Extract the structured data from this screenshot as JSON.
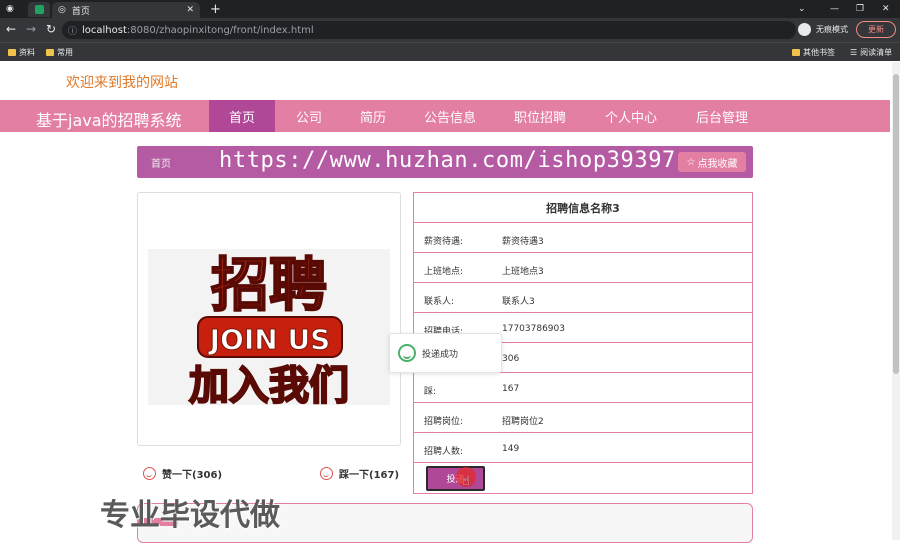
{
  "browser": {
    "tabs": [
      "",
      "首页"
    ],
    "url_host": "localhost",
    "url_rest": ":8080/zhaopinxitong/front/index.html",
    "profile_label": "无痕模式",
    "update_label": "更新",
    "bookmarks": [
      "资料",
      "常用"
    ],
    "bookmarks_right": [
      "其他书签",
      "阅读清单"
    ]
  },
  "site": {
    "welcome": "欢迎来到我的网站",
    "brand": "基于java的招聘系统",
    "nav": [
      "首页",
      "公司",
      "简历",
      "公告信息",
      "职位招聘",
      "个人中心",
      "后台管理"
    ]
  },
  "breadcrumb": {
    "home": "首页",
    "favorite": "点我收藏"
  },
  "watermark": {
    "url": "https://www.huzhan.com/ishop39397",
    "text": "专业毕设代做"
  },
  "poster": {
    "top": "招聘",
    "middle": "JOIN US",
    "bottom": "加入我们"
  },
  "job": {
    "title": "招聘信息名称3",
    "rows": [
      {
        "k": "薪资待遇:",
        "v": "薪资待遇3"
      },
      {
        "k": "上班地点:",
        "v": "上班地点3"
      },
      {
        "k": "联系人:",
        "v": "联系人3"
      },
      {
        "k": "招聘电话:",
        "v": "17703786903"
      },
      {
        "k": "",
        "v": "306"
      },
      {
        "k": "踩:",
        "v": "167"
      },
      {
        "k": "招聘岗位:",
        "v": "招聘岗位2"
      },
      {
        "k": "招聘人数:",
        "v": "149"
      }
    ],
    "apply": "投递"
  },
  "votes": {
    "up": "赞一下(306)",
    "down": "踩一下(167)"
  },
  "toast": "投递成功",
  "colors": {
    "nav": "#e47fa4",
    "active": "#b04897",
    "crumb": "#b55ba3",
    "welcome": "#e0792a"
  }
}
